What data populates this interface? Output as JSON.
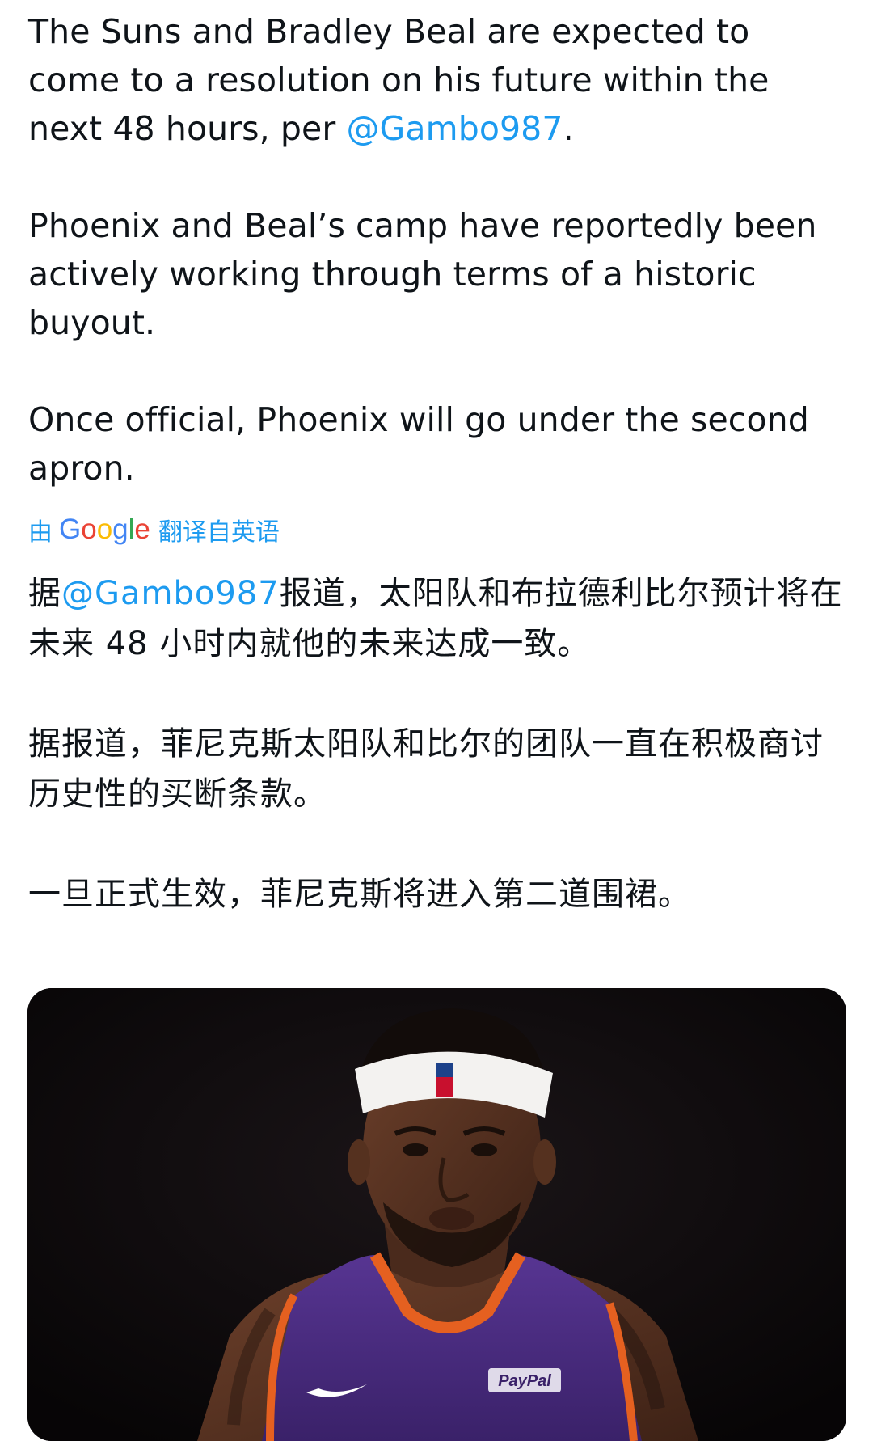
{
  "tweet": {
    "original": {
      "p1_before": "The Suns and Bradley Beal are expected to come to a resolution on his future within the next 48 hours, per ",
      "p1_mention": "@Gambo987",
      "p1_after": ".",
      "p2": "Phoenix and Beal’s camp have reportedly been actively working through terms of a historic buyout.",
      "p3": "Once official, Phoenix will go under the second apron."
    },
    "translation_bar": {
      "prefix": "由",
      "logo": "Google",
      "suffix": "翻译自英语"
    },
    "translated": {
      "p1_before": "据",
      "p1_mention": "@Gambo987",
      "p1_after": "报道，太阳队和布拉德利比尔预计将在未来 48 小时内就他的未来达成一致。",
      "p2": "据报道，菲尼克斯太阳队和比尔的团队一直在积极商讨历史性的买断条款。",
      "p3": "一旦正式生效，菲尼克斯将进入第二道围裙。"
    },
    "media": {
      "jersey_sponsor": "PayPal",
      "icon": "player-photo"
    }
  },
  "colors": {
    "text": "#0f1419",
    "link": "#1d9bf0",
    "jersey_purple": "#4b2d83",
    "jersey_orange": "#e56020"
  }
}
